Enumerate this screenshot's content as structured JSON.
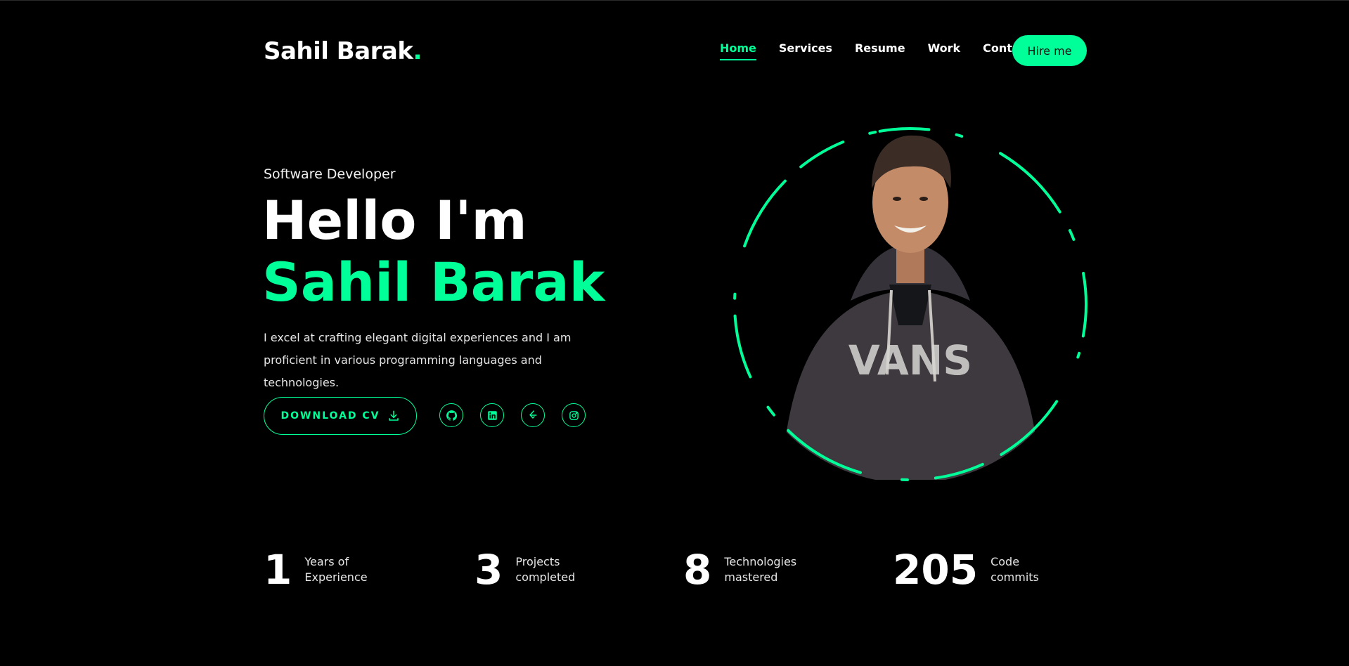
{
  "brand": {
    "name": "Sahil Barak",
    "dot": ".",
    "accent": "#00ff99"
  },
  "nav": {
    "items": [
      {
        "label": "Home",
        "active": true
      },
      {
        "label": "Services",
        "active": false
      },
      {
        "label": "Resume",
        "active": false
      },
      {
        "label": "Work",
        "active": false
      },
      {
        "label": "Contact",
        "active": false
      }
    ],
    "hire_label": "Hire me"
  },
  "hero": {
    "role": "Software Developer",
    "greeting": "Hello I'm",
    "name": "Sahil Barak",
    "bio": "I excel at crafting elegant digital experiences and I am proficient in various programming languages and technologies.",
    "cv_label": "DOWNLOAD CV",
    "cv_icon": "download-icon",
    "socials": [
      "github-icon",
      "linkedin-icon",
      "leetcode-icon",
      "instagram-icon"
    ]
  },
  "stats": [
    {
      "value": "1",
      "label": "Years of Experience"
    },
    {
      "value": "3",
      "label": "Projects completed"
    },
    {
      "value": "8",
      "label": "Technologies mastered"
    },
    {
      "value": "205",
      "label": "Code commits"
    }
  ]
}
